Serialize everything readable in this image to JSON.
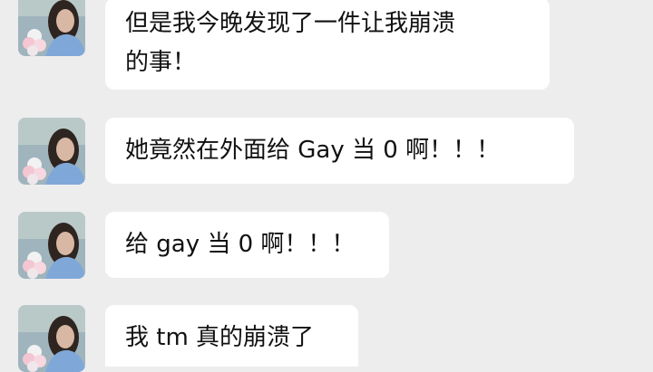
{
  "chat": {
    "messages": [
      {
        "sender": "contact",
        "text_lines": [
          "但是我今晚发现了一件让我崩溃",
          "的事！"
        ]
      },
      {
        "sender": "contact",
        "text_lines": [
          "她竟然在外面给 Gay 当 0 啊！！！"
        ]
      },
      {
        "sender": "contact",
        "text_lines": [
          "给 gay 当 0 啊！！！"
        ]
      },
      {
        "sender": "contact",
        "text_lines": [
          "我 tm 真的崩溃了"
        ]
      }
    ],
    "avatar_icon": "contact-avatar-photo"
  },
  "colors": {
    "background": "#ededed",
    "bubble": "#ffffff",
    "text": "#111111"
  }
}
